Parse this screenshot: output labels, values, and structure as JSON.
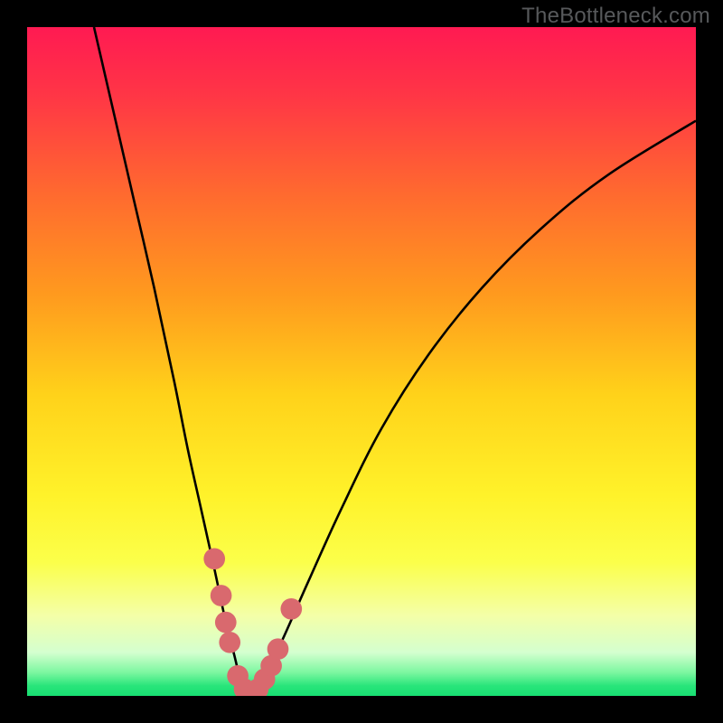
{
  "watermark": "TheBottleneck.com",
  "colors": {
    "frame_bg": "#000000",
    "curve": "#000000",
    "marker": "#d9696e",
    "gradient_stops": [
      {
        "offset": 0.0,
        "color": "#ff1a52"
      },
      {
        "offset": 0.1,
        "color": "#ff3546"
      },
      {
        "offset": 0.25,
        "color": "#ff6a2f"
      },
      {
        "offset": 0.4,
        "color": "#ff9a1e"
      },
      {
        "offset": 0.55,
        "color": "#ffd21a"
      },
      {
        "offset": 0.7,
        "color": "#fff22a"
      },
      {
        "offset": 0.8,
        "color": "#fbff4a"
      },
      {
        "offset": 0.88,
        "color": "#f4ffa8"
      },
      {
        "offset": 0.935,
        "color": "#d4ffcf"
      },
      {
        "offset": 0.965,
        "color": "#7cf7a0"
      },
      {
        "offset": 0.985,
        "color": "#28e57a"
      },
      {
        "offset": 1.0,
        "color": "#18de72"
      }
    ]
  },
  "chart_data": {
    "type": "line",
    "title": "",
    "xlabel": "",
    "ylabel": "",
    "xlim": [
      0,
      100
    ],
    "ylim": [
      0,
      100
    ],
    "x_optimum": 33,
    "series": [
      {
        "name": "bottleneck-curve-left",
        "x": [
          10,
          13,
          16,
          19,
          22,
          24,
          26,
          28,
          29.5,
          31,
          32,
          33
        ],
        "y": [
          100,
          87,
          74,
          61,
          47,
          37,
          28,
          19,
          12,
          6,
          2,
          0
        ]
      },
      {
        "name": "bottleneck-curve-right",
        "x": [
          33,
          35,
          38,
          42,
          47,
          53,
          60,
          68,
          77,
          87,
          100
        ],
        "y": [
          0,
          2,
          8,
          17,
          28,
          40,
          51,
          61,
          70,
          78,
          86
        ]
      }
    ],
    "markers": {
      "name": "sample-points",
      "points": [
        {
          "x": 28.0,
          "y": 20.5
        },
        {
          "x": 29.0,
          "y": 15.0
        },
        {
          "x": 29.7,
          "y": 11.0
        },
        {
          "x": 30.3,
          "y": 8.0
        },
        {
          "x": 31.5,
          "y": 3.0
        },
        {
          "x": 32.5,
          "y": 1.0
        },
        {
          "x": 33.5,
          "y": 0.5
        },
        {
          "x": 34.5,
          "y": 1.0
        },
        {
          "x": 35.5,
          "y": 2.5
        },
        {
          "x": 36.5,
          "y": 4.5
        },
        {
          "x": 37.5,
          "y": 7.0
        },
        {
          "x": 39.5,
          "y": 13.0
        }
      ],
      "radius_data_units": 1.6
    }
  }
}
